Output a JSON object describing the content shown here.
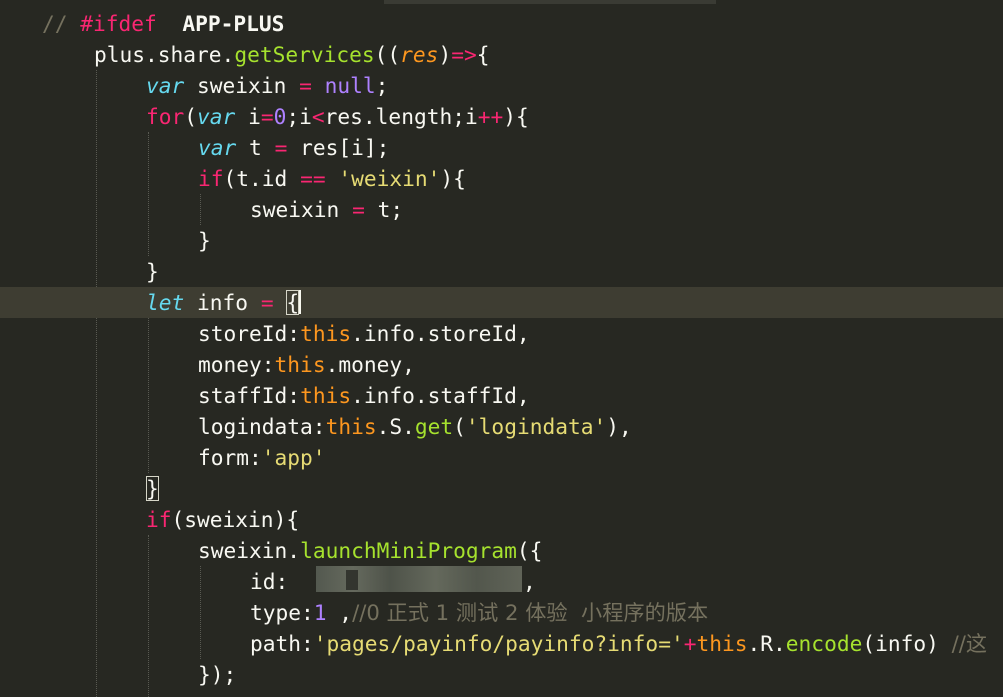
{
  "editor": {
    "theme_colors": {
      "background": "#272822",
      "keyword": "#F92672",
      "string": "#E6DB74",
      "number": "#AE81FF",
      "function": "#A6E22E",
      "storage": "#66D9EF",
      "this": "#FD971F",
      "comment": "#75715E"
    },
    "code": {
      "l1": {
        "comment": "//",
        "pp": "#ifdef",
        "target": "APP-PLUS"
      },
      "l2": {
        "a": "plus.share.",
        "fn": "getServices",
        "b": "((",
        "param": "res",
        "c": ")",
        "arrow": "=>",
        "d": "{"
      },
      "l3": {
        "kw": "var",
        "a": " sweixin ",
        "op": "=",
        "b": " ",
        "val": "null",
        "c": ";"
      },
      "l4": {
        "kw": "for",
        "a": "(",
        "kw2": "var",
        "b": " i",
        "op": "=",
        "num": "0",
        "c": ";i",
        "op2": "<",
        "d": "res.length;i",
        "op3": "++",
        "e": "){"
      },
      "l5": {
        "kw": "var",
        "a": " t ",
        "op": "=",
        "b": " res[i];"
      },
      "l6": {
        "kw": "if",
        "a": "(t.id ",
        "op": "==",
        "b": " ",
        "str": "'weixin'",
        "c": "){"
      },
      "l7": {
        "a": "sweixin ",
        "op": "=",
        "b": " t;"
      },
      "l8": {
        "a": "}"
      },
      "l9": {
        "a": "}"
      },
      "l10": {
        "kw": "let",
        "a": " info ",
        "op": "=",
        "b": " ",
        "brace": "{"
      },
      "l11": {
        "a": "storeId:",
        "this": "this",
        "b": ".info.storeId,"
      },
      "l12": {
        "a": "money:",
        "this": "this",
        "b": ".money,"
      },
      "l13": {
        "a": "staffId:",
        "this": "this",
        "b": ".info.staffId,"
      },
      "l14": {
        "a": "logindata:",
        "this": "this",
        "b": ".S.",
        "fn": "get",
        "c": "(",
        "str": "'logindata'",
        "d": "),"
      },
      "l15": {
        "a": "form:",
        "str": "'app'"
      },
      "l16": {
        "brace": "}"
      },
      "l17": {
        "kw": "if",
        "a": "(sweixin){"
      },
      "l18": {
        "a": "sweixin.",
        "fn": "launchMiniProgram",
        "b": "({"
      },
      "l19": {
        "a": "id:",
        "b": ","
      },
      "l20": {
        "a": "type:",
        "num": "1",
        "b": " ,",
        "comment": "//0 正式 1 测试 2 体验  小程序的版本"
      },
      "l21": {
        "a": "path:",
        "str": "'pages/payinfo/payinfo?info='",
        "op": "+",
        "this": "this",
        "b": ".R.",
        "fn": "encode",
        "c": "(info) ",
        "comment": "//这"
      },
      "l22": {
        "a": "});"
      }
    }
  }
}
